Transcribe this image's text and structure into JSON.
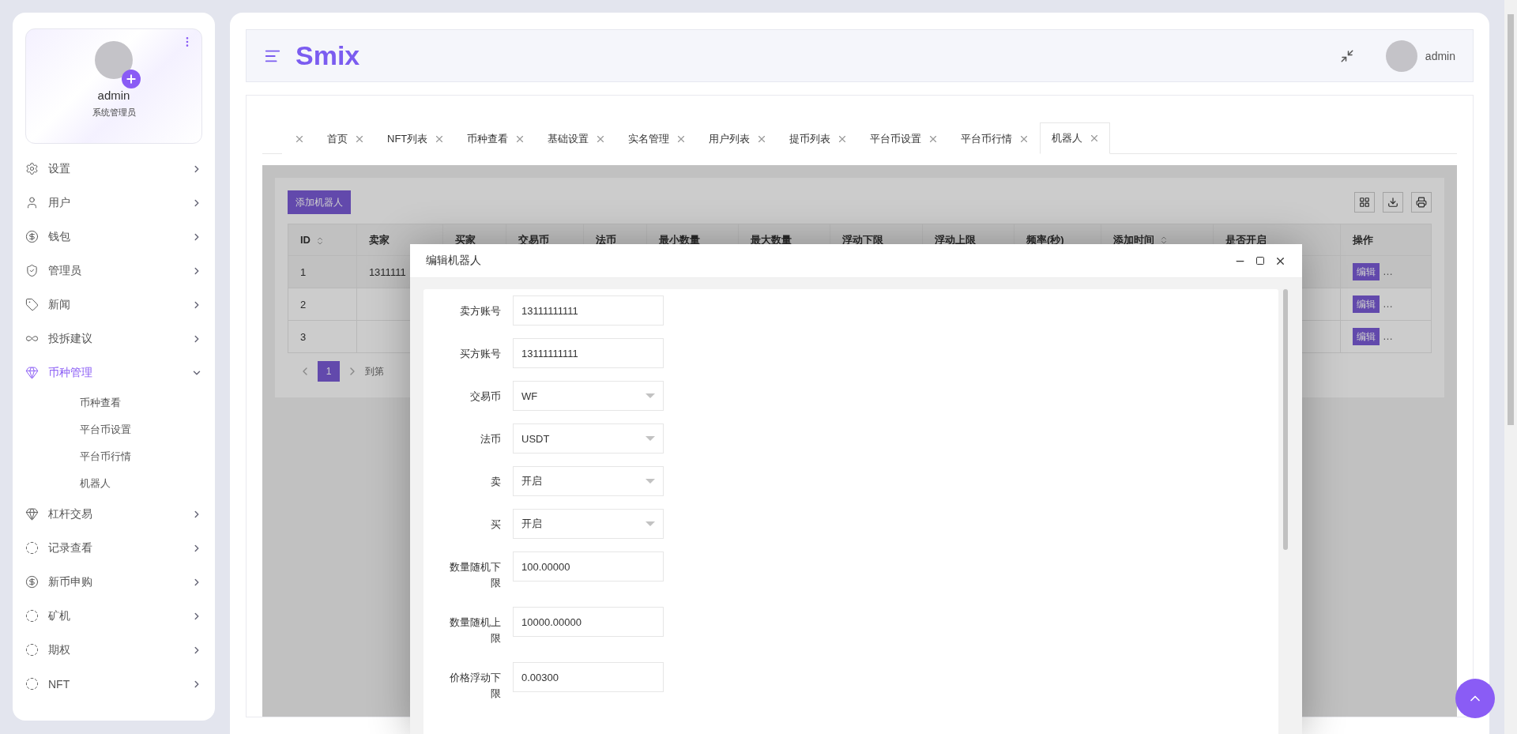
{
  "sidebar": {
    "profile": {
      "name": "admin",
      "role": "系统管理员"
    },
    "menu": [
      {
        "label": "设置",
        "expanded": false
      },
      {
        "label": "用户",
        "expanded": false
      },
      {
        "label": "钱包",
        "expanded": false
      },
      {
        "label": "管理员",
        "expanded": false
      },
      {
        "label": "新闻",
        "expanded": false
      },
      {
        "label": "投拆建议",
        "expanded": false
      },
      {
        "label": "币种管理",
        "expanded": true,
        "children": [
          {
            "label": "币种查看"
          },
          {
            "label": "平台币设置"
          },
          {
            "label": "平台币行情"
          },
          {
            "label": "机器人"
          }
        ]
      },
      {
        "label": "杠杆交易",
        "expanded": false
      },
      {
        "label": "记录查看",
        "expanded": false
      },
      {
        "label": "新币申购",
        "expanded": false
      },
      {
        "label": "矿机",
        "expanded": false
      },
      {
        "label": "期权",
        "expanded": false
      },
      {
        "label": "NFT",
        "expanded": false
      }
    ]
  },
  "header": {
    "logo": "Smix",
    "user": "admin"
  },
  "tabs": [
    {
      "selected": false
    },
    {
      "label": "首页",
      "selected": false
    },
    {
      "label": "NFT列表",
      "selected": false
    },
    {
      "label": "币种查看",
      "selected": false
    },
    {
      "label": "基础设置",
      "selected": false
    },
    {
      "label": "实名管理",
      "selected": false
    },
    {
      "label": "用户列表",
      "selected": false
    },
    {
      "label": "提币列表",
      "selected": false
    },
    {
      "label": "平台币设置",
      "selected": false
    },
    {
      "label": "平台币行情",
      "selected": false
    },
    {
      "label": "机器人",
      "selected": true
    }
  ],
  "table": {
    "add_button": "添加机器人",
    "columns": [
      {
        "label": "ID",
        "sortable": true
      },
      {
        "label": "卖家",
        "sortable": false
      },
      {
        "label": "买家",
        "sortable": false
      },
      {
        "label": "交易币",
        "sortable": false
      },
      {
        "label": "法币",
        "sortable": false
      },
      {
        "label": "最小数量",
        "sortable": false
      },
      {
        "label": "最大数量",
        "sortable": false
      },
      {
        "label": "浮动下限",
        "sortable": false
      },
      {
        "label": "浮动上限",
        "sortable": false
      },
      {
        "label": "频率(秒)",
        "sortable": false
      },
      {
        "label": "添加时间",
        "sortable": true
      },
      {
        "label": "是否开启",
        "sortable": false
      },
      {
        "label": "操作",
        "sortable": false
      }
    ],
    "rows": [
      {
        "id": "1",
        "seller": "1311111",
        "selected": true,
        "edit": "编辑",
        "more": "…"
      },
      {
        "id": "2",
        "selected": false,
        "edit": "编辑",
        "more": "…"
      },
      {
        "id": "3",
        "selected": false,
        "edit": "编辑",
        "more": "…"
      }
    ],
    "pagination": {
      "pages": [
        {
          "label": "1",
          "selected": true
        }
      ],
      "goto": "到第"
    }
  },
  "modal": {
    "title": "编辑机器人",
    "fields": [
      {
        "label": "卖方账号",
        "value": "13111111111",
        "kind": "input"
      },
      {
        "label": "买方账号",
        "value": "13111111111",
        "kind": "input"
      },
      {
        "label": "交易币",
        "value": "WF",
        "kind": "select"
      },
      {
        "label": "法币",
        "value": "USDT",
        "kind": "select"
      },
      {
        "label": "卖",
        "value": "开启",
        "kind": "select"
      },
      {
        "label": "买",
        "value": "开启",
        "kind": "select"
      },
      {
        "label": "数量随机下限",
        "value": "100.00000",
        "kind": "input"
      },
      {
        "label": "数量随机上限",
        "value": "10000.00000",
        "kind": "input"
      },
      {
        "label": "价格浮动下限",
        "value": "0.00300",
        "kind": "input"
      }
    ]
  }
}
